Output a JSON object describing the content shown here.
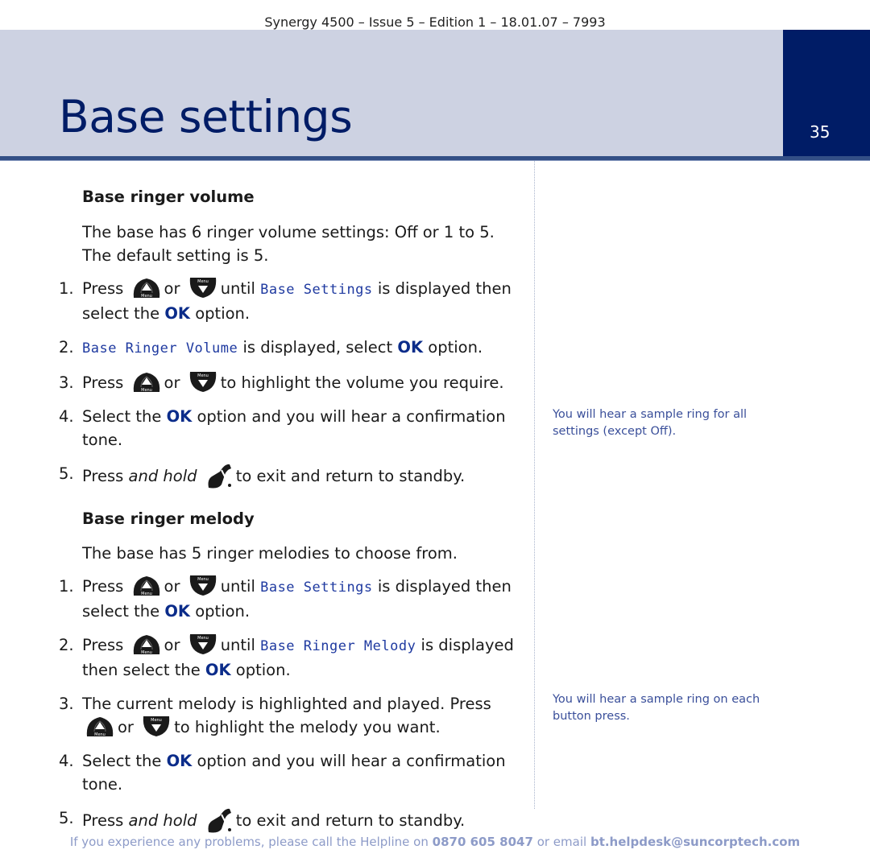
{
  "header": {
    "doc_info": "Synergy 4500 – Issue 5 –  Edition 1 – 18.01.07 – 7993"
  },
  "page": {
    "title": "Base settings",
    "number": "35"
  },
  "colors": {
    "brand_navy": "#001c66",
    "banner": "#cdd2e2",
    "lcd_text": "#1f3aa0",
    "note_text": "#3a4f9a",
    "footer_text": "#8d9bc8"
  },
  "sections": [
    {
      "heading": "Base ringer volume",
      "intro": "The base has 6 ringer volume settings: Off or 1 to 5. The default setting is 5.",
      "steps": [
        {
          "num": "1.",
          "press": "Press",
          "or": "or",
          "until": "until",
          "lcd": "Base Settings",
          "rest": "is displayed then select the",
          "ok": "OK",
          "tail": "option."
        },
        {
          "num": "2.",
          "lcd": "Base Ringer Volume",
          "rest": "is displayed, select",
          "ok": "OK",
          "tail": "option."
        },
        {
          "num": "3.",
          "press": "Press",
          "or": "or",
          "rest": "to highlight the volume you require."
        },
        {
          "num": "4.",
          "pre": "Select the",
          "ok": "OK",
          "rest": "option and you will hear a confirmation tone."
        },
        {
          "num": "5.",
          "press": "Press",
          "italic": "and hold",
          "rest": "to exit and return to standby."
        }
      ],
      "note": "You will hear a sample ring for all settings (except Off)."
    },
    {
      "heading": "Base ringer melody",
      "intro": "The base has 5 ringer melodies to choose from.",
      "steps": [
        {
          "num": "1.",
          "press": "Press",
          "or": "or",
          "until": "until",
          "lcd": "Base Settings",
          "rest": "is displayed then select the",
          "ok": "OK",
          "tail": "option."
        },
        {
          "num": "2.",
          "press": "Press",
          "or": "or",
          "until": "until",
          "lcd": "Base Ringer Melody",
          "rest": "is displayed then select the",
          "ok": "OK",
          "tail": "option."
        },
        {
          "num": "3.",
          "pre": "The current melody is highlighted and played. Press",
          "or": "or",
          "rest": "to highlight the melody you want."
        },
        {
          "num": "4.",
          "pre": "Select the",
          "ok": "OK",
          "rest": "option and you will hear a confirmation tone."
        },
        {
          "num": "5.",
          "press": "Press",
          "italic": "and hold",
          "rest": "to exit and return to standby."
        }
      ],
      "note": "You will hear a sample ring on each button press."
    }
  ],
  "keys": {
    "up_label": "Menu",
    "down_label": "Menu"
  },
  "footer": {
    "pre": "If you experience any problems, please call the Helpline on",
    "phone": "0870 605 8047",
    "mid": "or email",
    "email": "bt.helpdesk@suncorptech.com"
  }
}
